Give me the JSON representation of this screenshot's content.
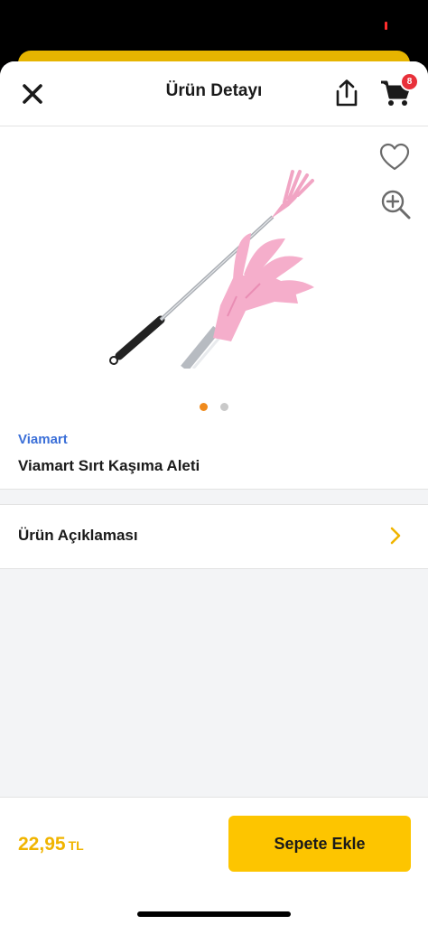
{
  "header": {
    "title": "Ürün Detayı",
    "close_icon": "close-icon",
    "share_icon": "share-icon",
    "cart_icon": "cart-icon",
    "cart_count": "8"
  },
  "product": {
    "brand": "Viamart",
    "name": "Viamart Sırt Kaşıma Aleti",
    "image_count": 2,
    "active_image": 1
  },
  "description": {
    "label": "Ürün Açıklaması"
  },
  "footer": {
    "price": "22,95",
    "currency": "TL",
    "add_to_cart_label": "Sepete Ekle"
  },
  "colors": {
    "brand_link": "#3b6fd8",
    "price": "#f0b400",
    "cta": "#fdc500",
    "badge": "#e8303a",
    "active_dot": "#f08a1c"
  }
}
